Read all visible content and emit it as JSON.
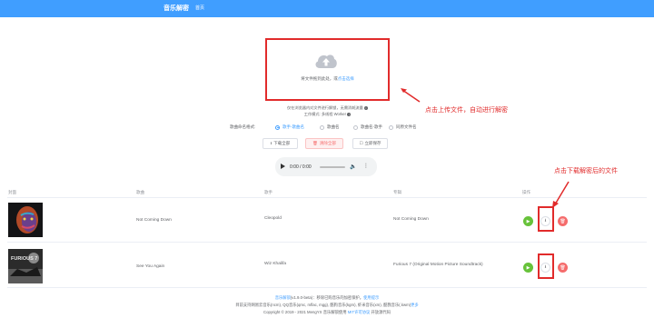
{
  "header": {
    "brand": "音乐解密",
    "nav_home": "首页"
  },
  "upload": {
    "text_prefix": "将文件拖到此处，或",
    "text_link": "点击选择",
    "tip1": "仅在浏览器内对文件进行解锁，无需消耗流量",
    "tip2": "工作模式: 多线程 Worker"
  },
  "annotations": {
    "upload_hint": "点击上传文件，自动进行解密",
    "download_hint": "点击下载解密后的文件"
  },
  "naming": {
    "label": "歌曲命名格式:",
    "options": [
      "歌手-歌曲名",
      "歌曲名",
      "歌曲名-歌手",
      "同原文件名"
    ],
    "selected": "歌手-歌曲名"
  },
  "actions": {
    "download_all": "下载全部",
    "clear_all": "清除全部",
    "save_now": "立即保存"
  },
  "player": {
    "time": "0:00 / 0:00"
  },
  "table": {
    "headers": [
      "封面",
      "歌曲",
      "歌手",
      "专辑",
      "操作"
    ],
    "rows": [
      {
        "song": "Not Coming Down",
        "artist": "Cleopold",
        "album": "Not Coming Down"
      },
      {
        "song": "See You Again",
        "artist": "Wiz Khalifa",
        "album": "Furious 7 (Original Motion Picture Soundtrack)",
        "cover_text": "FURIOUS 7"
      }
    ]
  },
  "footer": {
    "line1_link": "音乐解锁",
    "line1_text": "(v1.9.0-beta)：移除已购音乐的加密保护。",
    "line1_link2": "使用提示",
    "line2_text": "目前支持网易云音乐(ncm), QQ音乐(qmc, mflac, mgg), 酷狗音乐(kgm), 虾米音乐(xm), 酷我音乐(.kwm)",
    "line2_link": "更多",
    "line3_text": "Copyright © 2019 - 2021 MengYX 音乐解锁使用",
    "line3_link": "MIT许可协议",
    "line3_suffix": "开放源代码"
  },
  "colors": {
    "primary": "#409eff",
    "annotation": "#e12b2b",
    "success": "#67c23a",
    "danger": "#f56c6c"
  }
}
